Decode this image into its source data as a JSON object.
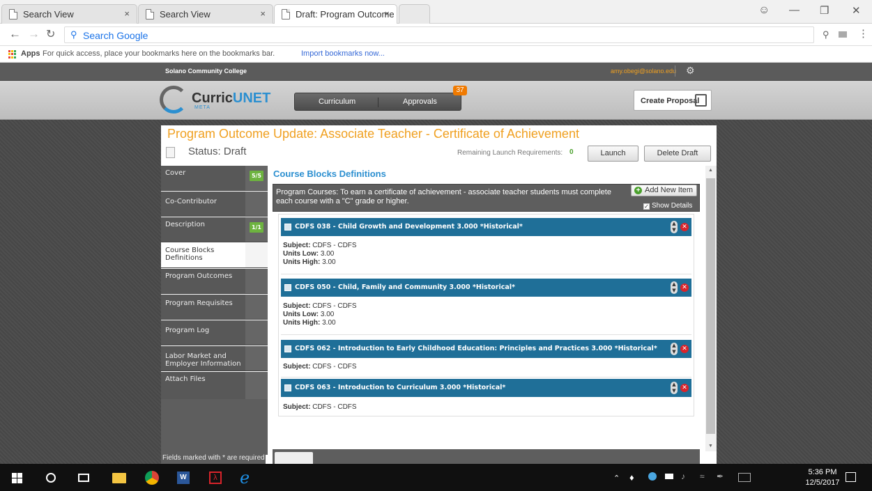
{
  "browser": {
    "tabs": [
      {
        "label": "Search View",
        "close": "×"
      },
      {
        "label": "Search View",
        "close": "×"
      },
      {
        "label": "Draft: Program Outcome",
        "close": "×"
      }
    ],
    "omnibox_placeholder": "Search Google",
    "bookmarks": {
      "apps_label": "Apps",
      "hint": "For quick access, place your bookmarks here on the bookmarks bar.",
      "import_link": "Import bookmarks now..."
    }
  },
  "site": {
    "college": "Solano Community College",
    "user_email": "amy.obegi@solano.edu",
    "logo_text": "Curric",
    "logo_text2": "UNET",
    "logo_sub": "META",
    "nav": {
      "curriculum": "Curriculum",
      "approvals": "Approvals",
      "approvals_badge": "37"
    },
    "create_proposal": "Create Proposal"
  },
  "page": {
    "title": "Program Outcome Update: Associate Teacher - Certificate of Achievement",
    "status": "Status: Draft",
    "remaining_label": "Remaining Launch Requirements:",
    "remaining_count": "0",
    "launch": "Launch",
    "delete_draft": "Delete Draft",
    "footnote": "Fields marked with * are required"
  },
  "sidebar": {
    "items": [
      {
        "label": "Cover",
        "badge": "5/5"
      },
      {
        "label": "Co-Contributor",
        "badge": ""
      },
      {
        "label": "Description",
        "badge": "1/1"
      },
      {
        "label": "Course Blocks Definitions",
        "badge": ""
      },
      {
        "label": "Program Outcomes",
        "badge": ""
      },
      {
        "label": "Program Requisites",
        "badge": ""
      },
      {
        "label": "Program Log",
        "badge": ""
      },
      {
        "label": "Labor Market and Employer Information",
        "badge": ""
      },
      {
        "label": "Attach Files",
        "badge": ""
      }
    ]
  },
  "content": {
    "heading": "Course Blocks Definitions",
    "program_courses": "Program Courses: To earn a certificate of achievement - associate teacher students must complete each course with a \"C\" grade or higher.",
    "add_new_item": "Add New Item",
    "show_details": "Show Details",
    "courses": [
      {
        "title": "CDFS 038 - Child Growth and Development 3.000 *Historical*",
        "subject": "CDFS - CDFS",
        "units_low": "3.00",
        "units_high": "3.00"
      },
      {
        "title": "CDFS 050 - Child, Family and Community 3.000 *Historical*",
        "subject": "CDFS - CDFS",
        "units_low": "3.00",
        "units_high": "3.00"
      },
      {
        "title": "CDFS 062 - Introduction to Early Childhood Education: Principles and Practices 3.000 *Historical*",
        "subject": "CDFS - CDFS"
      },
      {
        "title": "CDFS 063 - Introduction to Curriculum 3.000 *Historical*",
        "subject": "CDFS - CDFS"
      }
    ],
    "labels": {
      "subject": "Subject:",
      "units_low": "Units Low:",
      "units_high": "Units High:"
    }
  },
  "taskbar": {
    "time": "5:36 PM",
    "date": "12/5/2017"
  }
}
